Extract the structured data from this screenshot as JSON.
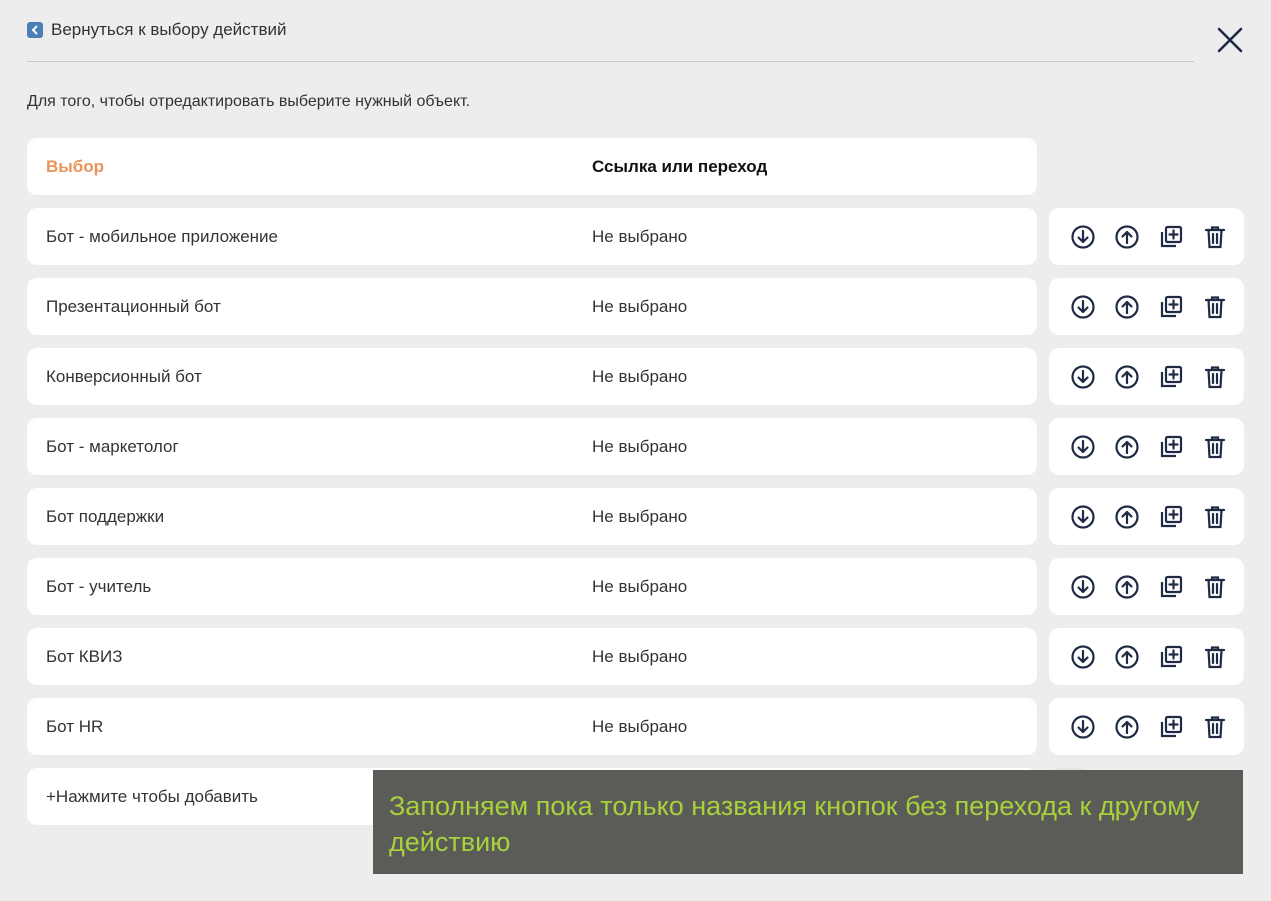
{
  "header": {
    "back_label": "Вернуться к выбору действий",
    "close_icon": "close-icon"
  },
  "instruction": "Для того, чтобы отредактировать выберите нужный объект.",
  "table": {
    "columns": [
      "Выбор",
      "Ссылка или переход"
    ],
    "rows": [
      {
        "name": "Бот - мобильное приложение",
        "link": "Не выбрано"
      },
      {
        "name": "Презентационный бот",
        "link": "Не выбрано"
      },
      {
        "name": "Конверсионный бот",
        "link": "Не выбрано"
      },
      {
        "name": "Бот - маркетолог",
        "link": "Не выбрано"
      },
      {
        "name": "Бот поддержки",
        "link": "Не выбрано"
      },
      {
        "name": "Бот - учитель",
        "link": "Не выбрано"
      },
      {
        "name": "Бот КВИЗ",
        "link": "Не выбрано"
      },
      {
        "name": "Бот HR",
        "link": "Не выбрано"
      }
    ],
    "row_actions": [
      "move-down-icon",
      "move-up-icon",
      "duplicate-icon",
      "trash-icon"
    ],
    "add_label": "+Нажмите чтобы добавить"
  },
  "overlay": {
    "text": "Заполняем пока только названия кнопок без перехода к другому действию"
  },
  "colors": {
    "accent": "#e9955a",
    "overlay_text": "#a7d23c",
    "overlay_bg": "#5b5b58"
  }
}
